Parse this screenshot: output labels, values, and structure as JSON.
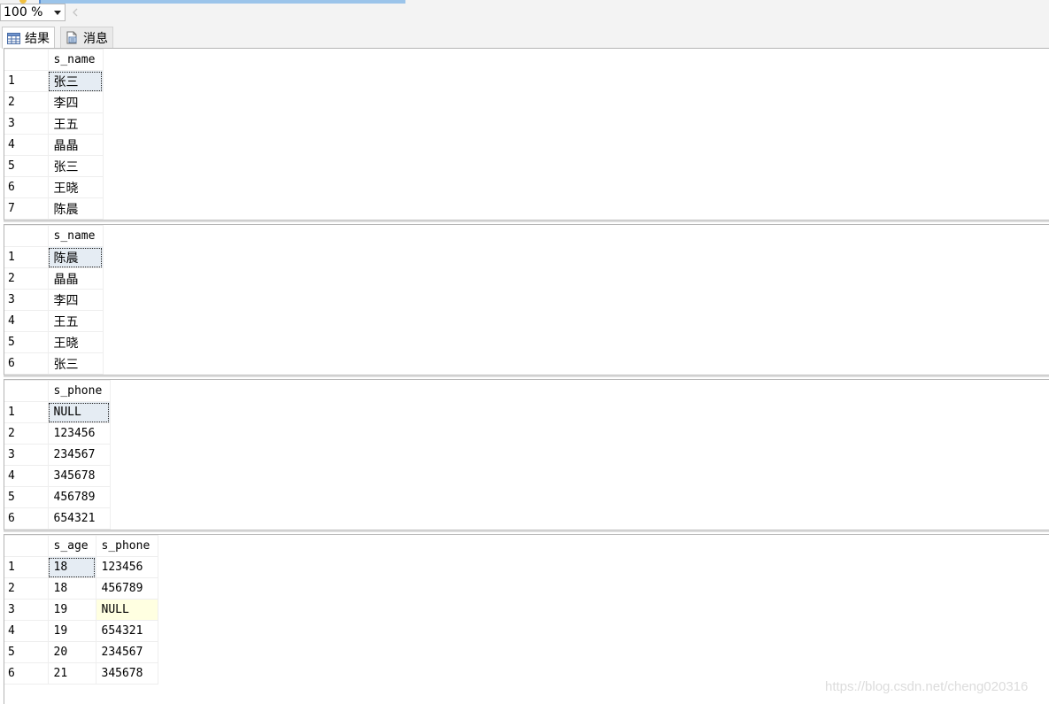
{
  "toolbar": {
    "zoom": "100 %"
  },
  "tabs": [
    {
      "label": "结果",
      "icon": "grid-icon"
    },
    {
      "label": "消息",
      "icon": "messages-icon"
    }
  ],
  "results": [
    {
      "columns": [
        "s_name"
      ],
      "rows": [
        [
          "张三"
        ],
        [
          "李四"
        ],
        [
          "王五"
        ],
        [
          "晶晶"
        ],
        [
          "张三"
        ],
        [
          "王晓"
        ],
        [
          "陈晨"
        ]
      ],
      "row_numbers": [
        "1",
        "2",
        "3",
        "4",
        "5",
        "6",
        "7"
      ]
    },
    {
      "columns": [
        "s_name"
      ],
      "rows": [
        [
          "陈晨"
        ],
        [
          "晶晶"
        ],
        [
          "李四"
        ],
        [
          "王五"
        ],
        [
          "王晓"
        ],
        [
          "张三"
        ]
      ],
      "row_numbers": [
        "1",
        "2",
        "3",
        "4",
        "5",
        "6"
      ]
    },
    {
      "columns": [
        "s_phone"
      ],
      "rows": [
        [
          "NULL"
        ],
        [
          "123456"
        ],
        [
          "234567"
        ],
        [
          "345678"
        ],
        [
          "456789"
        ],
        [
          "654321"
        ]
      ],
      "row_numbers": [
        "1",
        "2",
        "3",
        "4",
        "5",
        "6"
      ]
    },
    {
      "columns": [
        "s_age",
        "s_phone"
      ],
      "rows": [
        [
          "18",
          "123456"
        ],
        [
          "18",
          "456789"
        ],
        [
          "19",
          "NULL"
        ],
        [
          "19",
          "654321"
        ],
        [
          "20",
          "234567"
        ],
        [
          "21",
          "345678"
        ]
      ],
      "row_numbers": [
        "1",
        "2",
        "3",
        "4",
        "5",
        "6"
      ]
    }
  ],
  "watermark": "https://blog.csdn.net/cheng020316",
  "colors": {
    "selected_cell": "#e5ecf3",
    "null_highlight": "#ffffe1",
    "scroll_accent": "#9bc4ea"
  }
}
